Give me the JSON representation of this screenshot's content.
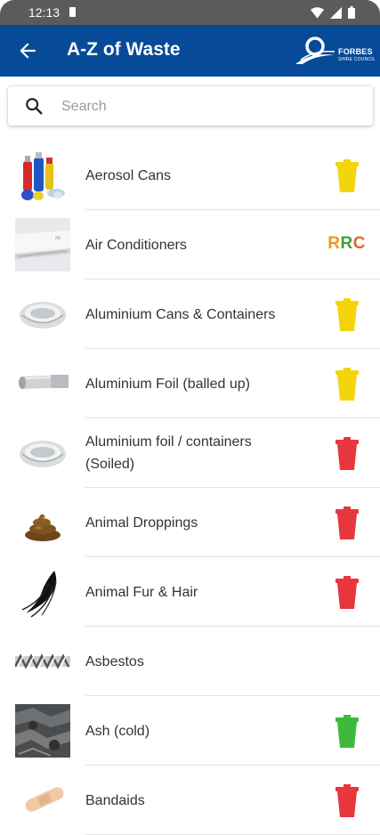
{
  "status_bar": {
    "time": "12:13"
  },
  "app_bar": {
    "title": "A-Z of Waste",
    "logo_name": "FORBES",
    "logo_sub": "SHIRE COUNCIL",
    "color": "#074a97"
  },
  "search": {
    "placeholder": "Search",
    "value": ""
  },
  "bin_colors": {
    "yellow": "#f4d50b",
    "red": "#e8363f",
    "green": "#3dba3d"
  },
  "rrc_colors": [
    "#e89a1c",
    "#3f9d44",
    "#e8652a"
  ],
  "items": [
    {
      "label": "Aerosol Cans",
      "thumb": "aerosol-cans-thumbnail",
      "disposal": "yellow-bin"
    },
    {
      "label": "Air Conditioners",
      "thumb": "air-conditioner-thumbnail",
      "disposal": "RRC"
    },
    {
      "label": "Aluminium Cans & Containers",
      "thumb": "aluminium-container-thumbnail",
      "disposal": "yellow-bin"
    },
    {
      "label": "Aluminium Foil (balled up)",
      "thumb": "aluminium-foil-thumbnail",
      "disposal": "yellow-bin"
    },
    {
      "label": "Aluminium foil / containers (Soiled)",
      "thumb": "aluminium-container-thumbnail",
      "disposal": "red-bin"
    },
    {
      "label": "Animal Droppings",
      "thumb": "animal-droppings-thumbnail",
      "disposal": "red-bin"
    },
    {
      "label": "Animal Fur & Hair",
      "thumb": "animal-fur-thumbnail",
      "disposal": "red-bin"
    },
    {
      "label": "Asbestos",
      "thumb": "asbestos-thumbnail",
      "disposal": "none"
    },
    {
      "label": "Ash (cold)",
      "thumb": "ash-thumbnail",
      "disposal": "green-bin"
    },
    {
      "label": "Bandaids",
      "thumb": "bandaids-thumbnail",
      "disposal": "red-bin"
    }
  ]
}
